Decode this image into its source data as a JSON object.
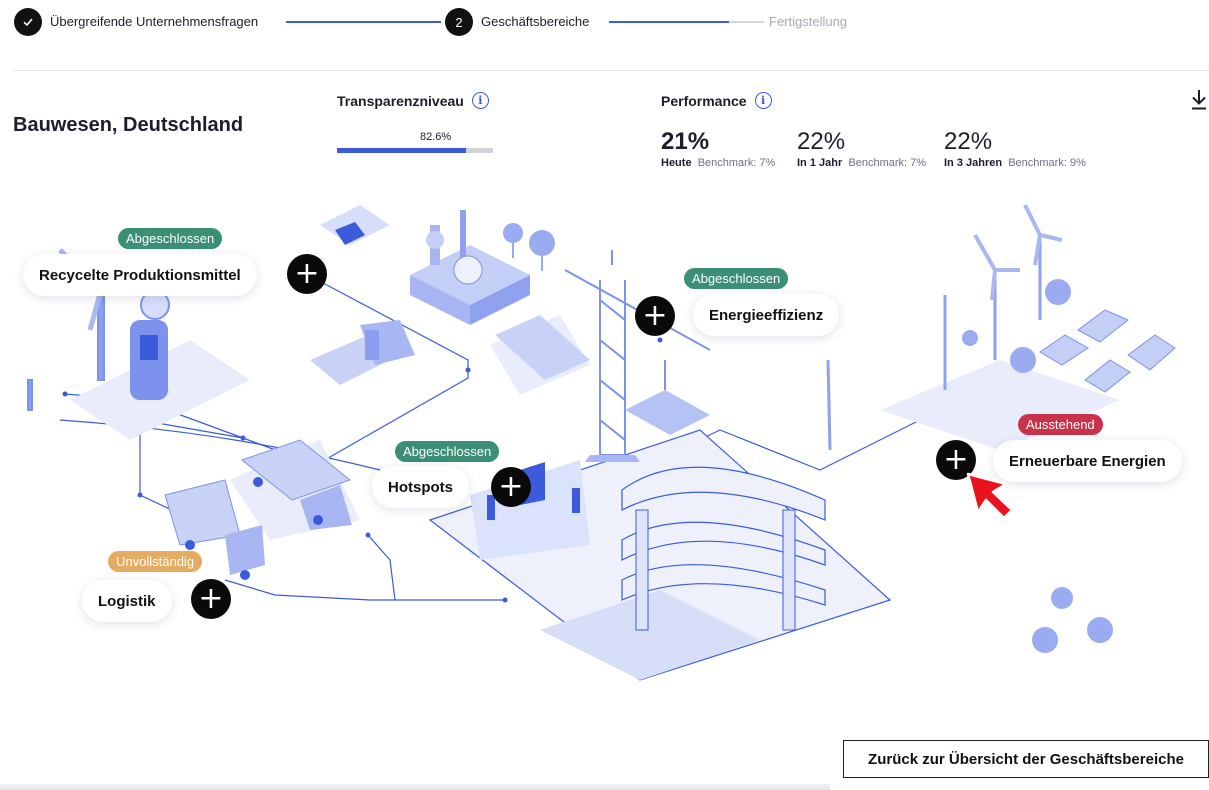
{
  "stepper": {
    "steps": [
      {
        "label": "Übergreifende Unternehmensfragen",
        "marker": "✓",
        "state": "done"
      },
      {
        "label": "Geschäftsbereiche",
        "marker": "2",
        "state": "active"
      },
      {
        "label": "Fertigstellung",
        "marker": "",
        "state": "pending"
      }
    ]
  },
  "header": {
    "title": "Bauwesen, Deutschland",
    "transparency": {
      "label": "Transparenzniveau",
      "value_text": "82.6%",
      "value": 82.6
    },
    "performance": {
      "label": "Performance",
      "columns": [
        {
          "value": "21%",
          "period": "Heute",
          "benchmark": "Benchmark: 7%"
        },
        {
          "value": "22%",
          "period": "In 1 Jahr",
          "benchmark": "Benchmark: 7%"
        },
        {
          "value": "22%",
          "period": "In 3 Jahren",
          "benchmark": "Benchmark: 9%"
        }
      ]
    }
  },
  "areas": {
    "recycelte": {
      "label": "Recycelte Produktionsmittel",
      "status": "Abgeschlossen"
    },
    "energieeffizienz": {
      "label": "Energieeffizienz",
      "status": "Abgeschlossen"
    },
    "hotspots": {
      "label": "Hotspots",
      "status": "Abgeschlossen"
    },
    "erneuerbare": {
      "label": "Erneuerbare Energien",
      "status": "Ausstehend"
    },
    "logistik": {
      "label": "Logistik",
      "status": "Unvollständig"
    }
  },
  "plus_symbol": "+",
  "info_symbol": "i",
  "colors": {
    "accent": "#3b5bdb",
    "abgeschlossen": "#3a8f76",
    "ausstehend": "#c8324b",
    "unvollstaendig": "#e3ac62",
    "cursor": "#e8141d"
  },
  "icons": [
    "check-icon",
    "info-icon",
    "download-icon",
    "plus-icon",
    "cursor-arrow-icon"
  ],
  "footer": {
    "back_label": "Zurück zur Übersicht der Geschäftsbereiche"
  }
}
